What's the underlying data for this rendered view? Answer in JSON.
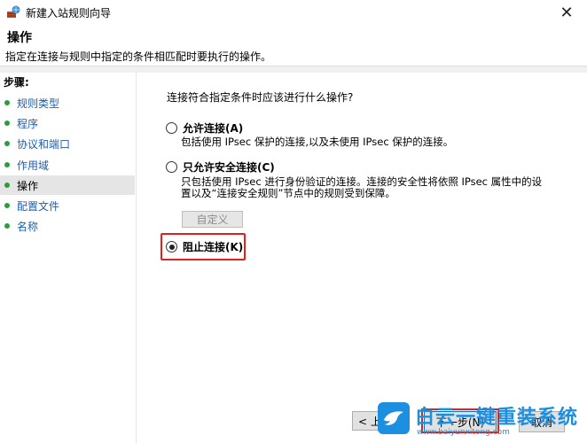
{
  "window": {
    "title": "新建入站规则向导",
    "close_symbol": "✕"
  },
  "header": {
    "title": "操作",
    "description": "指定在连接与规则中指定的条件相匹配时要执行的操作。"
  },
  "steps": {
    "label": "步骤:",
    "items": [
      {
        "label": "规则类型",
        "active": false
      },
      {
        "label": "程序",
        "active": false
      },
      {
        "label": "协议和端口",
        "active": false
      },
      {
        "label": "作用域",
        "active": false
      },
      {
        "label": "操作",
        "active": true
      },
      {
        "label": "配置文件",
        "active": false
      },
      {
        "label": "名称",
        "active": false
      }
    ]
  },
  "main": {
    "question": "连接符合指定条件时应该进行什么操作?",
    "options": [
      {
        "label": "允许连接(A)",
        "description": "包括使用 IPsec 保护的连接,以及未使用 IPsec 保护的连接。",
        "checked": false
      },
      {
        "label": "只允许安全连接(C)",
        "description_line1": "只包括使用 IPsec 进行身份验证的连接。连接的安全性将依照 IPsec 属性中的设",
        "description_line2": "置以及“连接安全规则”节点中的规则受到保障。",
        "checked": false
      },
      {
        "label": "阻止连接(K)",
        "checked": true
      }
    ],
    "custom_button": "自定义"
  },
  "buttons": {
    "prev": "< 上一步",
    "next": "下一步(N)",
    "cancel": "取消"
  },
  "watermark": {
    "text": "白云一键重装系统",
    "url": "www.baiyunxitong.com"
  }
}
